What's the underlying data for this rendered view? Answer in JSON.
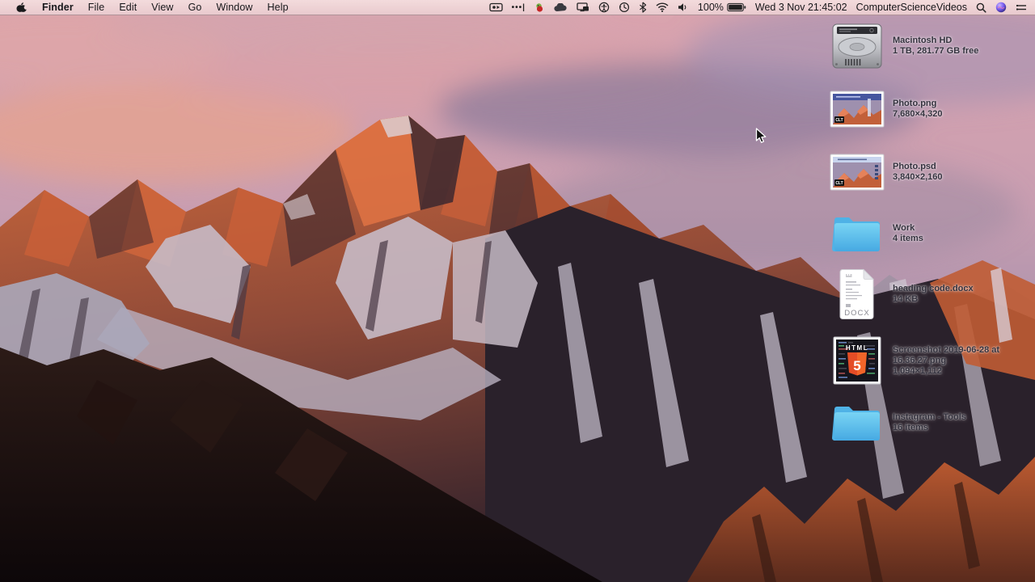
{
  "menu_bar": {
    "menus": [
      "Finder",
      "File",
      "Edit",
      "View",
      "Go",
      "Window",
      "Help"
    ],
    "status": {
      "battery_percent": "100%",
      "datetime": "Wed 3 Nov 21:45:02",
      "account_name": "ComputerScienceVideos"
    },
    "status_icon_names": [
      "screen-recording-icon",
      "input-dots-icon",
      "parrot-app-icon",
      "cloud-icon",
      "displays-icon",
      "accessibility-icon",
      "time-machine-icon",
      "bluetooth-icon",
      "wifi-icon",
      "volume-icon",
      "battery-icon",
      "spotlight-search-icon",
      "siri-icon",
      "notification-center-icon"
    ]
  },
  "desktop": {
    "icons": [
      {
        "name": "Macintosh HD",
        "info": "1 TB, 281.77 GB free",
        "type": "hard-drive"
      },
      {
        "name": "Photo.png",
        "info": "7,680×4,320",
        "type": "image",
        "badge": "CLT"
      },
      {
        "name": "Photo.psd",
        "info": "3,840×2,160",
        "type": "image",
        "badge": "CLT"
      },
      {
        "name": "Work",
        "info": "4 items",
        "type": "folder"
      },
      {
        "name": "heading code.docx",
        "info": "14 KB",
        "type": "word-document",
        "doc_label": "DOCX"
      },
      {
        "name": "Screenshot 2019-06-28 at 16.36.27.png",
        "info": "1,094×1,112",
        "type": "screenshot",
        "thumb_text": "HTML",
        "thumb_number": "5"
      },
      {
        "name": "Instagram - Tools",
        "info": "16 items",
        "type": "folder"
      }
    ]
  },
  "colors": {
    "menu_bar_bg": "#eed2d4",
    "folder_blue": "#5bc0ee",
    "html5_orange": "#e44d26",
    "label_text": "#34323e",
    "sky_pink": "#dba4ae",
    "mountain_orange": "#d0683c",
    "foreground_rock": "#150d10"
  }
}
